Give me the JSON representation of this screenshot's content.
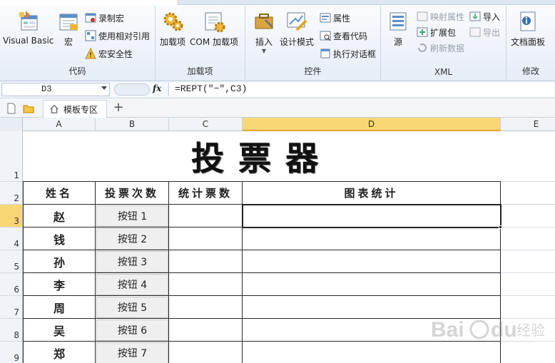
{
  "ribbon": {
    "groups": {
      "code": "代码",
      "addins": "加载项",
      "controls": "控件",
      "xml": "XML",
      "modify": "修改"
    },
    "buttons": {
      "visual_basic": "Visual Basic",
      "macro": "宏",
      "record_macro": "录制宏",
      "relative_refs": "使用相对引用",
      "macro_security": "宏安全性",
      "addins": "加载项",
      "com_addins": "COM 加载项",
      "insert": "插入",
      "design_mode": "设计模式",
      "properties": "属性",
      "view_code": "查看代码",
      "run_dialog": "执行对话框",
      "source": "源",
      "map_properties": "映射属性",
      "expansion_packs": "扩展包",
      "refresh_data": "刷新数据",
      "import": "导入",
      "export": "导出",
      "document_panel": "文档面板"
    }
  },
  "formula_bar": {
    "cell_ref": "D3",
    "fx": "fx",
    "formula": "=REPT(\"−\",C3)"
  },
  "tabstrip": {
    "doc_tab": "模板专区",
    "add": "+"
  },
  "grid": {
    "columns": [
      "A",
      "B",
      "C",
      "D",
      "E"
    ],
    "rows": [
      "1",
      "2",
      "3",
      "4",
      "5",
      "6",
      "7",
      "8",
      "9"
    ],
    "title": "投票器",
    "headers": [
      "姓名",
      "投票次数",
      "统计票数",
      "图表统计"
    ],
    "names": [
      "赵",
      "钱",
      "孙",
      "李",
      "周",
      "吴",
      "郑"
    ],
    "buttons": [
      "按钮 1",
      "按钮 2",
      "按钮 3",
      "按钮 4",
      "按钮 5",
      "按钮 6",
      "按钮 7"
    ],
    "selected_col": "D",
    "selected_row": "3"
  },
  "colors": {
    "selection_header": "#f9d674",
    "ribbon_bg": "#e6edf7"
  },
  "watermark": "Baidu 经验"
}
